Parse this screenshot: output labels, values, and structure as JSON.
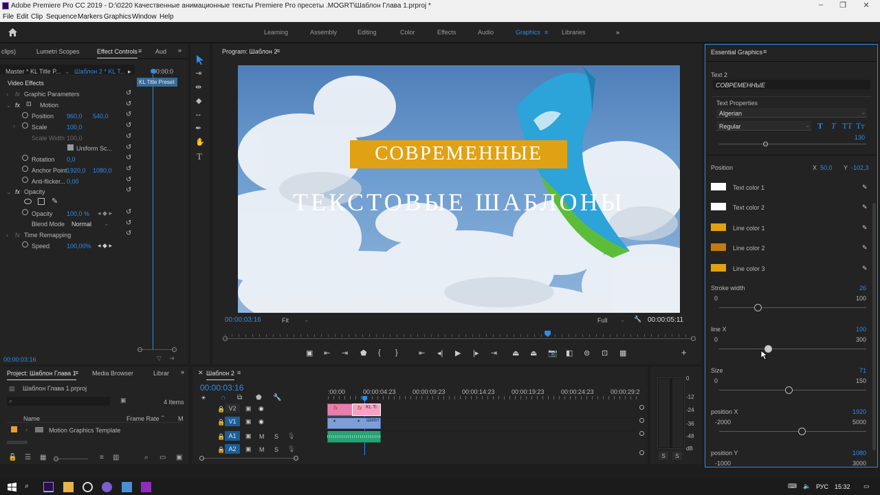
{
  "titlebar": {
    "title": "Adobe Premiere Pro CC 2019 - D:\\0220 Качественные анимационные тексты   Premiere Pro пресеты  .MOGRT\\Шаблон Глава 1.prproj *"
  },
  "menu": [
    "File",
    "Edit",
    "Clip",
    "Sequence",
    "Markers",
    "Graphics",
    "Window",
    "Help"
  ],
  "workspaces": [
    "Learning",
    "Assembly",
    "Editing",
    "Color",
    "Effects",
    "Audio",
    "Graphics",
    "Libraries"
  ],
  "effect_controls": {
    "tabs": [
      "clips)",
      "Lumetri Scopes",
      "Effect Controls",
      "Aud"
    ],
    "master": "Master * KL Title P...",
    "clip": "Шаблон 2 * KL T...",
    "time_head": "00:00:0",
    "preset_label": "KL Title Preset",
    "video_effects": "Video Effects",
    "graphic_params": "Graphic Parameters",
    "motion": "Motion",
    "position_label": "Position",
    "position_x": "960,0",
    "position_y": "540,0",
    "scale_label": "Scale",
    "scale_val": "100,0",
    "scale_width_label": "Scale Width",
    "scale_width_val": "100,0",
    "uniform": "Uniform Sc...",
    "rotation_label": "Rotation",
    "rotation_val": "0,0",
    "anchor_label": "Anchor Point",
    "anchor_x": "1920,0",
    "anchor_y": "1080,0",
    "antiflicker_label": "Anti-flicker...",
    "antiflicker_val": "0,00",
    "opacity_header": "Opacity",
    "opacity_label": "Opacity",
    "opacity_val": "100,0 %",
    "blend_label": "Blend Mode",
    "blend_val": "Normal",
    "time_remap": "Time Remapping",
    "speed_label": "Speed",
    "speed_val": "100,00%",
    "timecode": "00:00:03:16"
  },
  "program": {
    "title": "Program: Шаблон 2",
    "overlay_line1": "СОВРЕМЕННЫЕ",
    "overlay_line2": "ТЕКСТОВЫЕ ШАБЛОНЫ",
    "timecode": "00:00:03:16",
    "fit": "Fit",
    "quality": "Full",
    "duration": "00:00:05:11",
    "playhead_fraction": 0.69
  },
  "project": {
    "tabs": [
      "Project: Шаблон Глава 1",
      "Media Browser",
      "Librar"
    ],
    "file": "Шаблон Глава 1.prproj",
    "count": "4 Items",
    "col_name": "Name",
    "col_rate": "Frame Rate",
    "col_m": "M",
    "item": "Motion Graphics Template"
  },
  "timeline": {
    "title": "Шаблон 2",
    "timecode": "00:00:03:16",
    "ruler": [
      ":00:00",
      "00:00:04:23",
      "00:00:09:23",
      "00:00:14:23",
      "00:00:19:23",
      "00:00:24:23",
      "00:00:29:2"
    ],
    "tracks": [
      "V2",
      "V1",
      "A1",
      "A2"
    ],
    "clip_v2": "KL Ti",
    "clip_v1": "Шабл",
    "fx": "fx"
  },
  "meter": {
    "labels": [
      "0",
      "-12",
      "-24",
      "-36",
      "-48",
      "dB"
    ],
    "solo": [
      "S",
      "S"
    ]
  },
  "essential": {
    "title": "Essential Graphics",
    "text_label": "Text 2",
    "text_value": "СОВРЕМЕННЫЕ",
    "text_props": "Text Properties",
    "font": "Algerian",
    "style": "Regular",
    "font_size": "130",
    "position_label": "Position",
    "pos_x_l": "X",
    "pos_x": "50,0",
    "pos_y_l": "Y",
    "pos_y": "-102,3",
    "colors": [
      {
        "label": "Text color 1",
        "hex": "#ffffff"
      },
      {
        "label": "Text color 2",
        "hex": "#ffffff"
      },
      {
        "label": "Line color 1",
        "hex": "#e0a214"
      },
      {
        "label": "Line color 2",
        "hex": "#c27b10"
      },
      {
        "label": "Line color 3",
        "hex": "#e0a214"
      }
    ],
    "sliders": [
      {
        "label": "Stroke width",
        "value": "26",
        "min": "0",
        "max": "100",
        "level": 0.26
      },
      {
        "label": "line X",
        "value": "100",
        "min": "0",
        "max": "300",
        "level": 0.333
      },
      {
        "label": "Size",
        "value": "71",
        "min": "0",
        "max": "150",
        "level": 0.473
      },
      {
        "label": "position X",
        "value": "1920",
        "min": "-2000",
        "max": "5000",
        "level": 0.56
      },
      {
        "label": "position Y",
        "value": "1080",
        "min": "-1000",
        "max": "3000"
      }
    ]
  },
  "taskbar": {
    "lang": "РУС",
    "time": "15:32"
  }
}
